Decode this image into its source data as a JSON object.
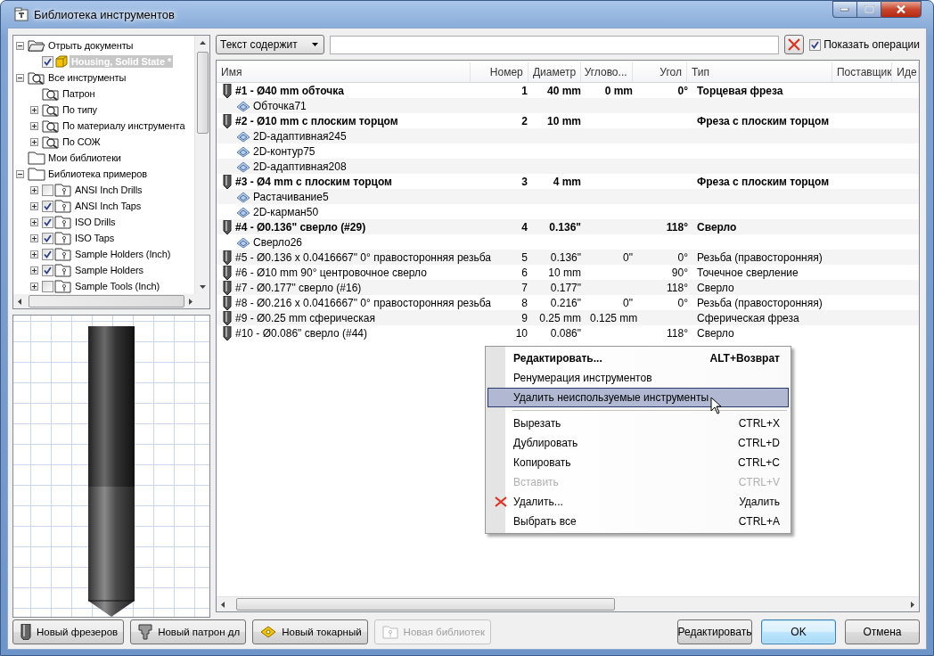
{
  "window": {
    "title": "Библиотека инструментов"
  },
  "tree": [
    {
      "label": "Отрыть документы",
      "expanded": true,
      "children": [
        {
          "label": "Housing, Solid State *",
          "checked": true,
          "selected": true
        }
      ]
    },
    {
      "label": "Все инструменты",
      "expanded": true,
      "children": [
        {
          "label": "Патрон"
        },
        {
          "label": "По типу",
          "expanded": false
        },
        {
          "label": "По материалу инструмента",
          "expanded": false
        },
        {
          "label": "По СОЖ",
          "expanded": false
        }
      ]
    },
    {
      "label": "Мои библиотеки"
    },
    {
      "label": "Библиотека примеров",
      "expanded": true,
      "children": [
        {
          "label": "ANSI Inch Drills",
          "expanded": false,
          "checked": false
        },
        {
          "label": "ANSI Inch Taps",
          "expanded": false,
          "checked": true
        },
        {
          "label": "ISO Drills",
          "expanded": false,
          "checked": true
        },
        {
          "label": "ISO Taps",
          "expanded": false,
          "checked": true
        },
        {
          "label": "Sample Holders (Inch)",
          "expanded": false,
          "checked": true
        },
        {
          "label": "Sample Holders",
          "expanded": false,
          "checked": true
        },
        {
          "label": "Sample Tools (Inch)",
          "expanded": false,
          "checked": false
        }
      ]
    }
  ],
  "filter": {
    "mode": "Текст содержит",
    "show_operations": {
      "label": "Показать операции",
      "checked": true
    }
  },
  "table": {
    "columns": [
      "Имя",
      "Номер",
      "Диаметр",
      "Углово...",
      "Угол",
      "Тип",
      "Поставщик",
      "Иде"
    ],
    "rows": [
      {
        "kind": "tool",
        "used": true,
        "name": "#1 - Ø40 mm обточка",
        "number": "1",
        "diameter": "40 mm",
        "column_4": "0 mm",
        "angle": "0°",
        "type": "Торцевая фреза"
      },
      {
        "kind": "operation",
        "name": "Обточка71"
      },
      {
        "kind": "tool",
        "used": true,
        "name": "#2 - Ø10 mm с плоским торцом",
        "number": "2",
        "diameter": "10 mm",
        "type": "Фреза с плоским торцом"
      },
      {
        "kind": "operation",
        "name": "2D-адаптивная245"
      },
      {
        "kind": "operation",
        "name": "2D-контур75"
      },
      {
        "kind": "operation",
        "name": "2D-адаптивная208"
      },
      {
        "kind": "tool",
        "used": true,
        "name": "#3 - Ø4 mm с плоским торцом",
        "number": "3",
        "diameter": "4 mm",
        "type": "Фреза с плоским торцом"
      },
      {
        "kind": "operation",
        "name": "Растачивание5"
      },
      {
        "kind": "operation",
        "name": "2D-карман50"
      },
      {
        "kind": "tool",
        "used": true,
        "name": "#4 - Ø0.136\" сверло (#29)",
        "number": "4",
        "diameter": "0.136\"",
        "angle": "118°",
        "type": "Сверло"
      },
      {
        "kind": "operation",
        "name": "Сверло26"
      },
      {
        "kind": "tool",
        "used": false,
        "name": "#5 - Ø0.136 x 0.0416667\" 0° правосторонняя резьба",
        "number": "5",
        "diameter": "0.136\"",
        "column_4": "0\"",
        "angle": "0°",
        "type": "Резьба (правосторонняя)"
      },
      {
        "kind": "tool",
        "used": false,
        "name": "#6 - Ø10 mm 90° центровочное сверло",
        "number": "6",
        "diameter": "10 mm",
        "angle": "90°",
        "type": "Точечное сверление"
      },
      {
        "kind": "tool",
        "used": false,
        "name": "#7 - Ø0.177\" сверло (#16)",
        "number": "7",
        "diameter": "0.177\"",
        "angle": "118°",
        "type": "Сверло"
      },
      {
        "kind": "tool",
        "used": false,
        "name": "#8 - Ø0.216 x 0.0416667\" 0° правосторонняя резьба",
        "number": "8",
        "diameter": "0.216\"",
        "column_4": "0\"",
        "angle": "0°",
        "type": "Резьба (правосторонняя)"
      },
      {
        "kind": "tool",
        "used": false,
        "name": "#9 - Ø0.25 mm сферическая",
        "number": "9",
        "diameter": "0.25 mm",
        "column_4": "0.125 mm",
        "type": "Сферическая фреза"
      },
      {
        "kind": "tool",
        "used": false,
        "name": "#10 - Ø0.086\" сверло (#44)",
        "number": "10",
        "diameter": "0.086\"",
        "angle": "118°",
        "type": "Сверло"
      }
    ]
  },
  "context_menu": [
    {
      "kind": "item",
      "label": "Редактировать...",
      "shortcut": "ALT+Возврат",
      "default": true,
      "selected": false,
      "disabled": false
    },
    {
      "kind": "item",
      "label": "Ренумерация инструментов",
      "selected": false,
      "disabled": false
    },
    {
      "kind": "item",
      "label": "Удалить неиспользуемые инструменты",
      "selected": true,
      "disabled": false
    },
    {
      "kind": "separator"
    },
    {
      "kind": "item",
      "label": "Вырезать",
      "shortcut": "CTRL+X",
      "selected": false,
      "disabled": false
    },
    {
      "kind": "item",
      "label": "Дублировать",
      "shortcut": "CTRL+D",
      "selected": false,
      "disabled": false
    },
    {
      "kind": "item",
      "label": "Копировать",
      "shortcut": "CTRL+C",
      "selected": false,
      "disabled": false
    },
    {
      "kind": "item",
      "label": "Вставить",
      "shortcut": "CTRL+V",
      "selected": false,
      "disabled": true
    },
    {
      "kind": "danger",
      "label": "Удалить...",
      "shortcut": "Удалить",
      "selected": false,
      "disabled": false
    },
    {
      "kind": "item",
      "label": "Выбрать все",
      "shortcut": "CTRL+A",
      "selected": false,
      "disabled": false
    }
  ],
  "footer_left": [
    {
      "kind": "mill",
      "label": "Новый фрезеров",
      "disabled": false
    },
    {
      "kind": "holder",
      "label": "Новый патрон дл",
      "disabled": false
    },
    {
      "kind": "turning",
      "label": "Новый токарный",
      "disabled": false
    },
    {
      "kind": "library",
      "label": "Новая библиотек",
      "disabled": true
    }
  ],
  "footer_right": [
    {
      "label": "Редактировать",
      "default": false
    },
    {
      "label": "OK",
      "default": true
    },
    {
      "label": "Отмена",
      "default": false
    }
  ]
}
